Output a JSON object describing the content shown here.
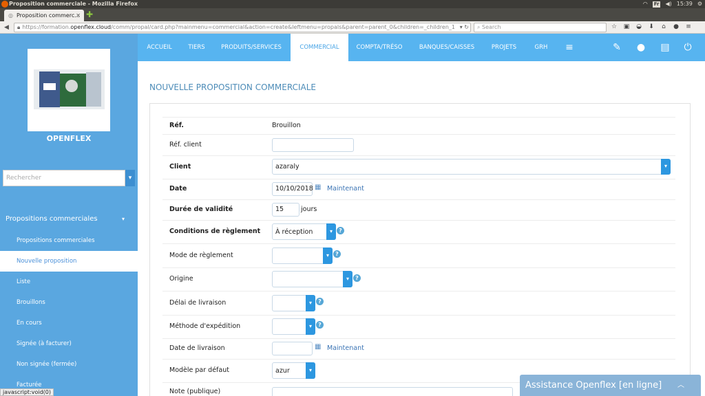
{
  "os": {
    "window_title": "Proposition commerciale - Mozilla Firefox",
    "time": "15:39",
    "keyboard": "Fr"
  },
  "browser": {
    "tab_title": "Proposition commerc...",
    "url_prefix": "https://formation.",
    "url_host": "openflex.cloud",
    "url_path": "/comm/propal/card.php?mainmenu=commercial&action=create&leftmenu=propals&parent=parent_0&children=_children_1",
    "search_placeholder": "Search"
  },
  "sidebar": {
    "company_name": "OPENFLEX",
    "search_placeholder": "Rechercher",
    "menu_title": "Propositions commerciales",
    "items": [
      {
        "label": "Propositions commerciales",
        "active": false
      },
      {
        "label": "Nouvelle proposition",
        "active": true
      },
      {
        "label": "Liste",
        "active": false
      },
      {
        "label": "Brouillons",
        "active": false
      },
      {
        "label": "En cours",
        "active": false
      },
      {
        "label": "Signée (à facturer)",
        "active": false
      },
      {
        "label": "Non signée (fermée)",
        "active": false
      },
      {
        "label": "Facturée",
        "active": false
      }
    ]
  },
  "topnav": {
    "items": [
      "ACCUEIL",
      "TIERS",
      "PRODUITS/SERVICES",
      "COMMERCIAL",
      "COMPTA/TRÉSO",
      "BANQUES/CAISSES",
      "PROJETS",
      "GRH"
    ],
    "active": "COMMERCIAL"
  },
  "page": {
    "title": "NOUVELLE PROPOSITION COMMERCIALE"
  },
  "form": {
    "ref_label": "Réf.",
    "ref_value": "Brouillon",
    "ref_client_label": "Réf. client",
    "ref_client_value": "",
    "client_label": "Client",
    "client_value": "azaraly",
    "date_label": "Date",
    "date_value": "10/10/2018",
    "now_link": "Maintenant",
    "validity_label": "Durée de validité",
    "validity_value": "15",
    "validity_unit": "jours",
    "payment_terms_label": "Conditions de règlement",
    "payment_terms_value": "À réception",
    "payment_mode_label": "Mode de règlement",
    "origin_label": "Origine",
    "delivery_delay_label": "Délai de livraison",
    "shipping_method_label": "Méthode d'expédition",
    "delivery_date_label": "Date de livraison",
    "delivery_now_link": "Maintenant",
    "default_model_label": "Modèle par défaut",
    "default_model_value": "azur",
    "public_note_label": "Note (publique)"
  },
  "chat": {
    "label": "Assistance Openflex [en ligne]"
  },
  "statusbar": {
    "text": "javascript:void(0)"
  },
  "colors": {
    "sidebar": "#5aa7e0",
    "topnav": "#57b4f0",
    "accent_button": "#2d97e0",
    "title": "#4d8cb8"
  }
}
